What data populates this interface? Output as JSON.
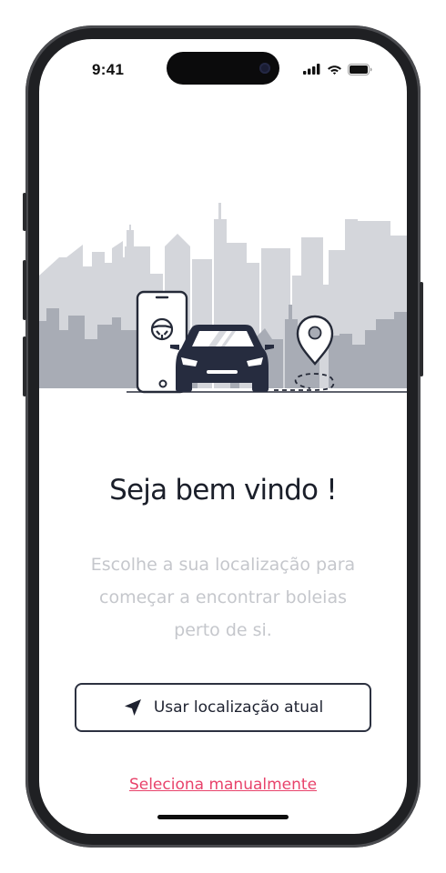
{
  "status_bar": {
    "time": "9:41"
  },
  "welcome": {
    "title": "Seja bem vindo !",
    "subtitle": "Escolhe a sua localização para começar a encontrar boleias perto de si."
  },
  "actions": {
    "use_location_label": "Usar localização atual",
    "manual_link_label": "Seleciona manualmente"
  },
  "icons": {
    "navigation_arrow": "location-arrow-icon",
    "status": [
      "signal-icon",
      "wifi-icon",
      "battery-icon"
    ],
    "illustration": [
      "city-skyline",
      "smartphone-icon",
      "steering-wheel-icon",
      "car-icon",
      "map-pin-icon"
    ]
  },
  "colors": {
    "title": "#1b1f2a",
    "subtitle": "#c5c7cc",
    "button_border": "#2c3140",
    "link": "#e8436b",
    "car": "#262c3f",
    "skyline_back": "#d3d5da",
    "skyline_front": "#a9adb6"
  }
}
